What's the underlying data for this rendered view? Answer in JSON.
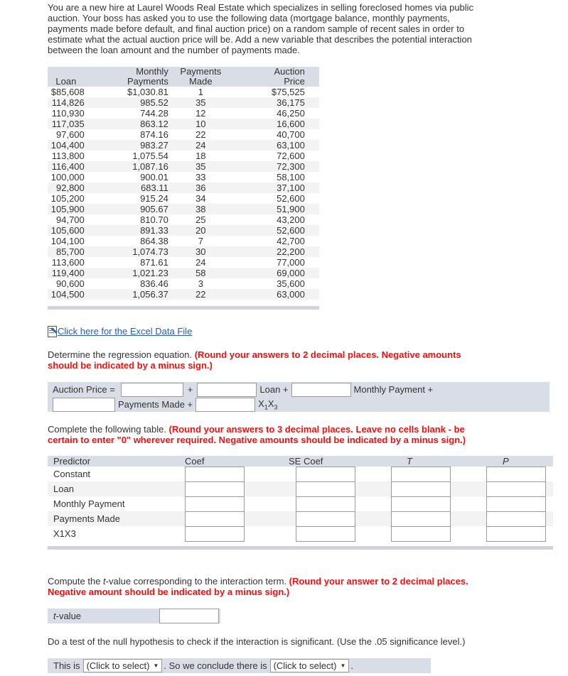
{
  "intro": "You are a new hire at Laurel Woods Real Estate which specializes in selling foreclosed homes via public auction. Your boss has asked you to use the following data (mortgage balance, monthly payments, payments made before default, and final auction price) on a random sample of recent sales in order to estimate what the actual auction price will be. Add a new variable that describes the potential interaction between the loan amount and the number of payments made.",
  "data_table": {
    "headers": {
      "loan": "Loan",
      "monthly_1": "Monthly",
      "monthly_2": "Payments",
      "payments_1": "Payments",
      "payments_2": "Made",
      "auction_1": "Auction",
      "auction_2": "Price"
    },
    "rows": [
      {
        "loan": "$85,608",
        "monthly": "$1,030.81",
        "payments": "1",
        "auction": "$75,525"
      },
      {
        "loan": "114,826",
        "monthly": "985.52",
        "payments": "35",
        "auction": "36,175"
      },
      {
        "loan": "110,930",
        "monthly": "744.28",
        "payments": "12",
        "auction": "46,250"
      },
      {
        "loan": "117,035",
        "monthly": "863.12",
        "payments": "10",
        "auction": "16,600"
      },
      {
        "loan": "97,600",
        "monthly": "874.16",
        "payments": "22",
        "auction": "40,700"
      },
      {
        "loan": "104,400",
        "monthly": "983.27",
        "payments": "24",
        "auction": "63,100"
      },
      {
        "loan": "113,800",
        "monthly": "1,075.54",
        "payments": "18",
        "auction": "72,600"
      },
      {
        "loan": "116,400",
        "monthly": "1,087.16",
        "payments": "35",
        "auction": "72,300"
      },
      {
        "loan": "100,000",
        "monthly": "900.01",
        "payments": "33",
        "auction": "58,100"
      },
      {
        "loan": "92,800",
        "monthly": "683.11",
        "payments": "36",
        "auction": "37,100"
      },
      {
        "loan": "105,200",
        "monthly": "915.24",
        "payments": "34",
        "auction": "52,600"
      },
      {
        "loan": "105,900",
        "monthly": "905.67",
        "payments": "38",
        "auction": "51,900"
      },
      {
        "loan": "94,700",
        "monthly": "810.70",
        "payments": "25",
        "auction": "43,200"
      },
      {
        "loan": "105,600",
        "monthly": "891.33",
        "payments": "20",
        "auction": "52,600"
      },
      {
        "loan": "104,100",
        "monthly": "864.38",
        "payments": "7",
        "auction": "42,700"
      },
      {
        "loan": "85,700",
        "monthly": "1,074.73",
        "payments": "30",
        "auction": "22,200"
      },
      {
        "loan": "113,600",
        "monthly": "871.61",
        "payments": "24",
        "auction": "77,000"
      },
      {
        "loan": "119,400",
        "monthly": "1,021.23",
        "payments": "58",
        "auction": "69,000"
      },
      {
        "loan": "90,600",
        "monthly": "836.46",
        "payments": "3",
        "auction": "35,600"
      },
      {
        "loan": "104,500",
        "monthly": "1,056.37",
        "payments": "22",
        "auction": "63,000"
      }
    ]
  },
  "excel_link": "Click here for the Excel Data File",
  "q1": {
    "text": "Determine the regression equation. ",
    "instruction": "(Round your answers to 2 decimal places. Negative amounts should be indicated by a minus sign.)"
  },
  "equation": {
    "lhs": "Auction Price =",
    "plus": "+",
    "loan": "Loan +",
    "monthly": "Monthly Payment +",
    "payments": "Payments Made +",
    "interaction_x": "X",
    "interaction_s1": "1",
    "interaction_s2": "3"
  },
  "q2": {
    "text": "Complete the following table. ",
    "instruction": "(Round your answers to 3 decimal places. Leave no cells blank - be certain to enter \"0\" wherever required. Negative amounts should be indicated by a minus sign.)"
  },
  "reg_table": {
    "headers": {
      "predictor": "Predictor",
      "coef": "Coef",
      "se": "SE Coef",
      "t": "T",
      "p": "P"
    },
    "rows": [
      "Constant",
      "Loan",
      "Monthly Payment",
      "Payments Made",
      "X1X3"
    ]
  },
  "q3": {
    "text_pre": "Compute the ",
    "text_t": "t",
    "text_post": "-value corresponding to the interaction term. ",
    "instruction": "(Round your answer to 2 decimal places. Negative amount should be indicated by a minus sign.)"
  },
  "tvalue": {
    "label_t": "t",
    "label_rest": "-value"
  },
  "q4": {
    "text": "Do a test of the null hypothesis to check if the interaction is significant. (Use the .05 significance level.)"
  },
  "conclusion": {
    "pre": "This is",
    "select1": "(Click to select)",
    "mid": ". So we conclude there is",
    "select2": "(Click to select)",
    "end": ".",
    "arrow": "▼"
  }
}
